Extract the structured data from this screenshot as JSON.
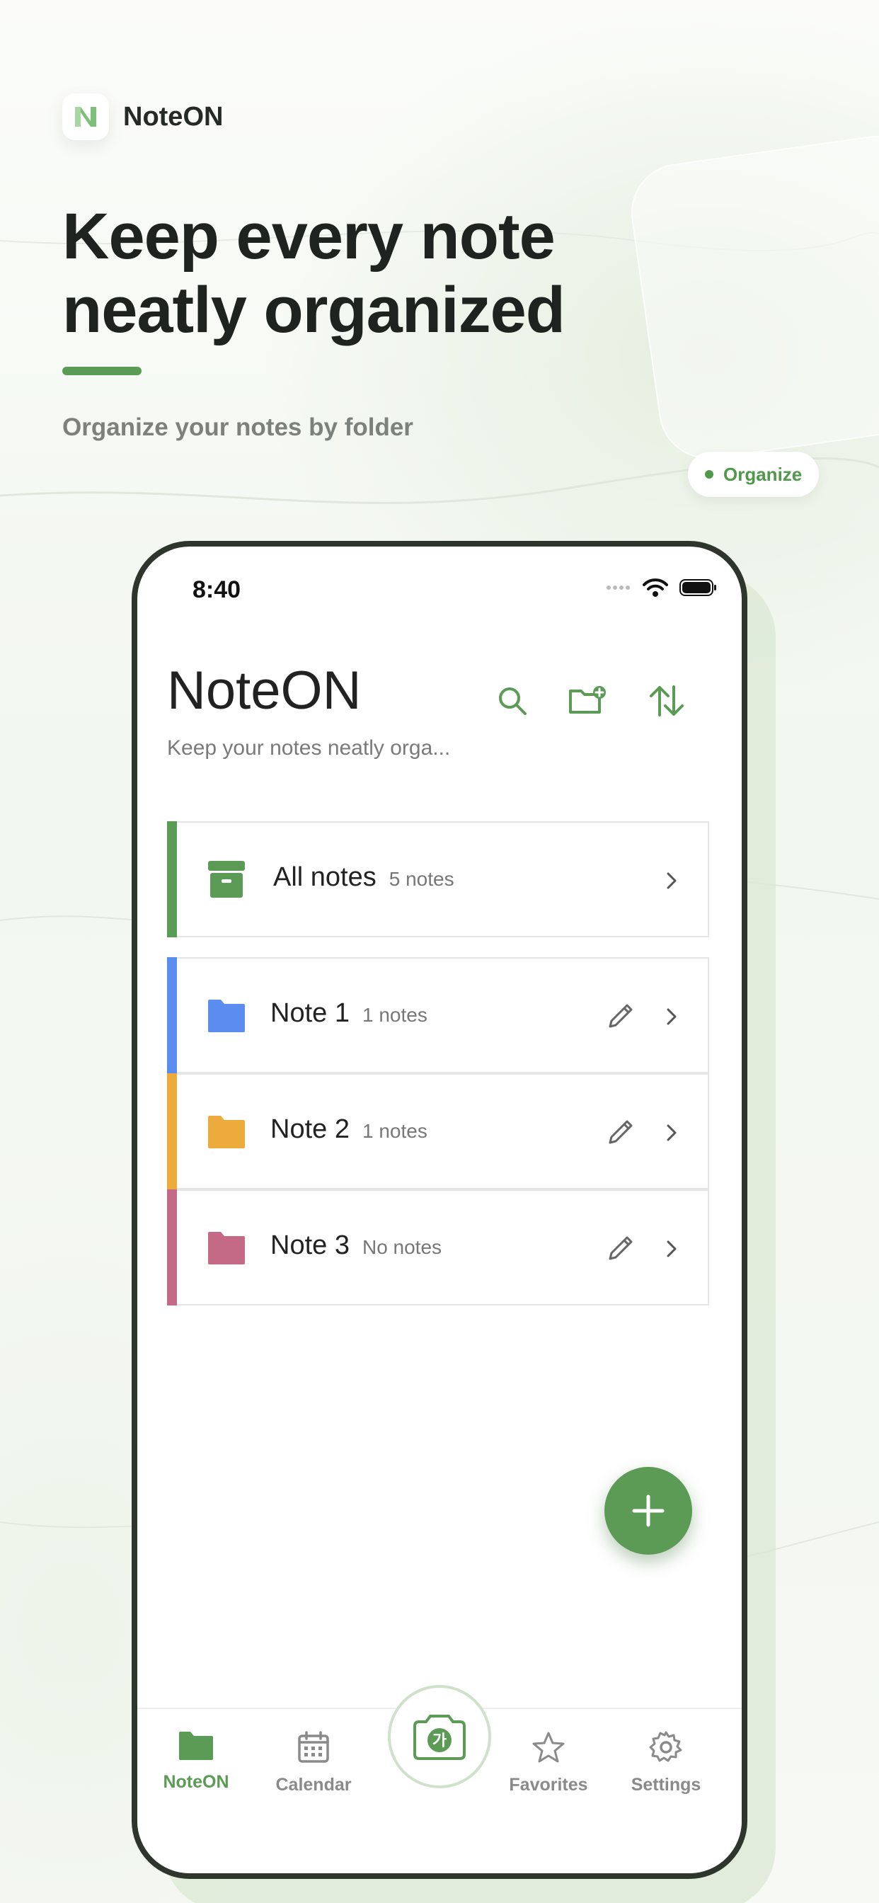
{
  "brand": {
    "name": "NoteON"
  },
  "hero": {
    "headline_line1": "Keep every note",
    "headline_line2": "neatly organized",
    "subheadline": "Organize your notes by folder",
    "chip": "Organize"
  },
  "status_bar": {
    "time": "8:40"
  },
  "app": {
    "title": "NoteON",
    "subtitle": "Keep your notes neatly orga...",
    "header_icons": [
      "search-icon",
      "new-folder-icon",
      "sort-icon"
    ]
  },
  "folders": [
    {
      "name": "All notes",
      "count": "5 notes",
      "color": "#5c9b56",
      "icon": "archive-icon"
    },
    {
      "name": "Note 1",
      "count": "1 notes",
      "color": "#5b8def",
      "icon": "folder-icon"
    },
    {
      "name": "Note 2",
      "count": "1 notes",
      "color": "#eeab3d",
      "icon": "folder-icon"
    },
    {
      "name": "Note 3",
      "count": "No notes",
      "color": "#c56a86",
      "icon": "folder-icon"
    }
  ],
  "tabbar": {
    "items": [
      {
        "label": "NoteON",
        "icon": "folder-icon",
        "active": true
      },
      {
        "label": "Calendar",
        "icon": "calendar-icon",
        "active": false
      },
      {
        "label": "",
        "icon": "camera-icon",
        "active": false
      },
      {
        "label": "Favorites",
        "icon": "star-icon",
        "active": false
      },
      {
        "label": "Settings",
        "icon": "gear-icon",
        "active": false
      }
    ],
    "camera_glyph": "가"
  },
  "colors": {
    "accent": "#5c9b56",
    "text": "#222222",
    "muted": "#777777"
  }
}
